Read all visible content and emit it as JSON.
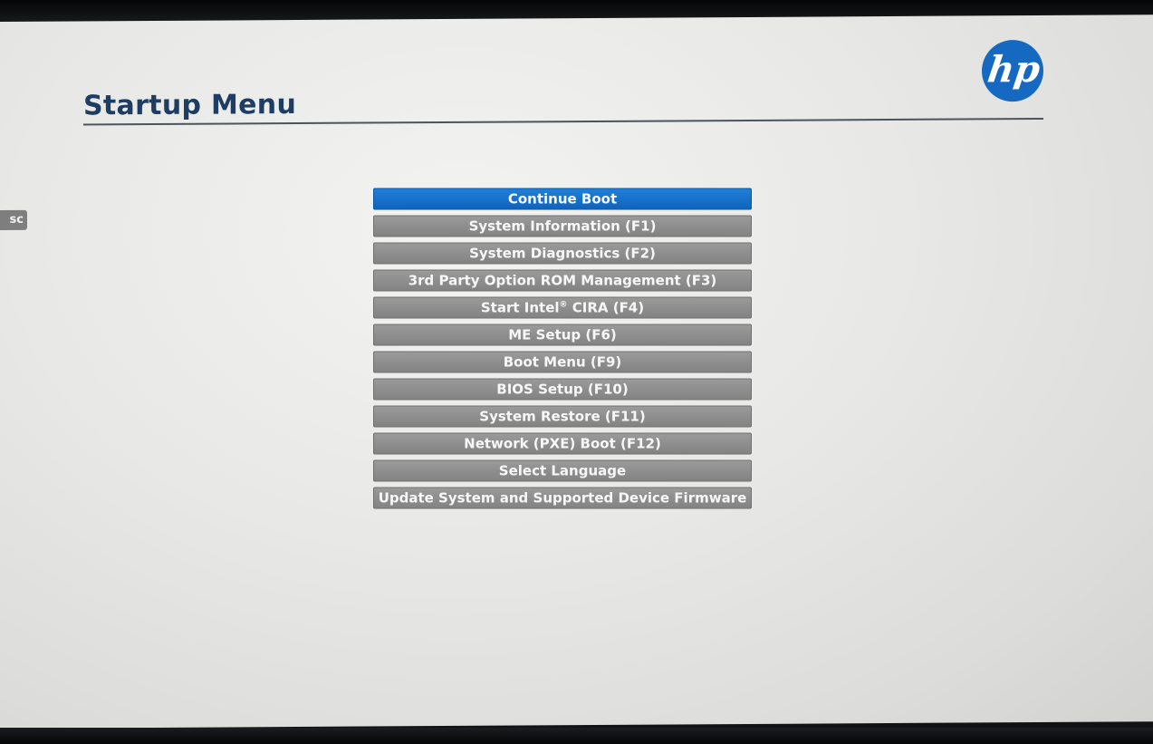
{
  "page": {
    "title": "Startup Menu",
    "brand_logo_text": "hp",
    "esc_label": "sc"
  },
  "colors": {
    "title": "#1d3d63",
    "selected_item": "#1373d0",
    "unselected_item": "#8c8c8c",
    "logo": "#1669c0",
    "background": "#e8e8e6"
  },
  "menu": {
    "selected_index": 0,
    "items": [
      {
        "label": "Continue Boot"
      },
      {
        "label": "System Information (F1)"
      },
      {
        "label": "System Diagnostics (F2)"
      },
      {
        "label": "3rd Party Option ROM Management (F3)"
      },
      {
        "label_prefix": "Start Intel",
        "label_mark": "®",
        "label_suffix": " CIRA (F4)"
      },
      {
        "label": "ME Setup (F6)"
      },
      {
        "label": "Boot Menu (F9)"
      },
      {
        "label": "BIOS Setup (F10)"
      },
      {
        "label": "System Restore (F11)"
      },
      {
        "label": "Network (PXE) Boot (F12)"
      },
      {
        "label": "Select Language"
      },
      {
        "label": "Update System and Supported Device Firmware"
      }
    ]
  }
}
